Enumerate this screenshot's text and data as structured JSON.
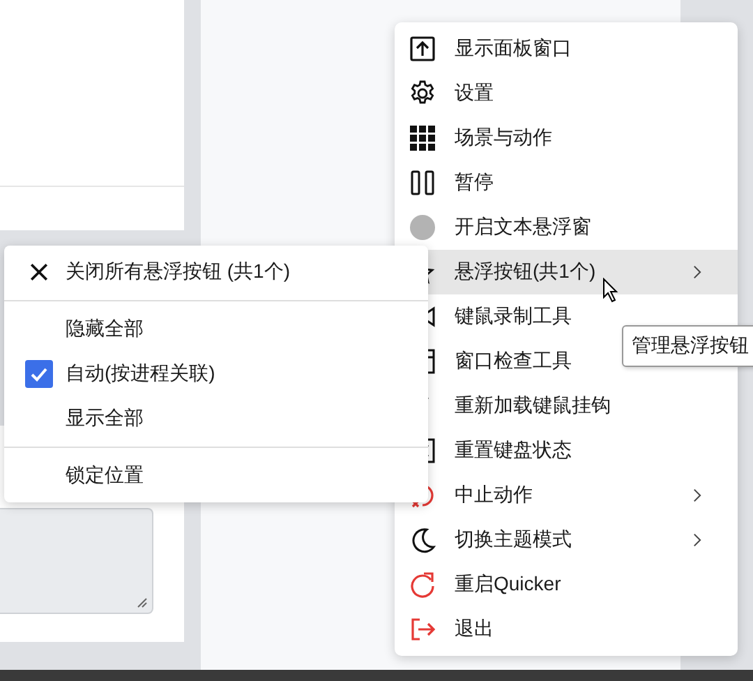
{
  "menu": {
    "items": [
      {
        "label": "显示面板窗口",
        "kind": "panel",
        "submenu": false,
        "highlighted": false
      },
      {
        "label": "设置",
        "kind": "gear",
        "submenu": false,
        "highlighted": false
      },
      {
        "label": "场景与动作",
        "kind": "grid",
        "submenu": false,
        "highlighted": false
      },
      {
        "label": "暂停",
        "kind": "pause",
        "submenu": false,
        "highlighted": false
      },
      {
        "label": "开启文本悬浮窗",
        "kind": "dot",
        "submenu": false,
        "highlighted": false
      },
      {
        "label": "悬浮按钮(共1个)",
        "kind": "float",
        "submenu": true,
        "highlighted": true
      },
      {
        "label": "键鼠录制工具",
        "kind": "record",
        "submenu": false,
        "highlighted": false
      },
      {
        "label": "窗口检查工具",
        "kind": "window",
        "submenu": false,
        "highlighted": false
      },
      {
        "label": "重新加载键鼠挂钩",
        "kind": "hook",
        "submenu": false,
        "highlighted": false
      },
      {
        "label": "重置键盘状态",
        "kind": "key",
        "submenu": false,
        "highlighted": false
      },
      {
        "label": "中止动作",
        "kind": "stop",
        "submenu": true,
        "highlighted": false
      },
      {
        "label": "切换主题模式",
        "kind": "moon",
        "submenu": true,
        "highlighted": false
      },
      {
        "label": "重启Quicker",
        "kind": "restart",
        "submenu": false,
        "highlighted": false
      },
      {
        "label": "退出",
        "kind": "exit",
        "submenu": false,
        "highlighted": false
      }
    ]
  },
  "submenu": {
    "items": [
      {
        "kind": "close",
        "label": "关闭所有悬浮按钮 (共1个)"
      },
      {
        "kind": "separator"
      },
      {
        "kind": "check",
        "label": "隐藏全部",
        "checked": false
      },
      {
        "kind": "check",
        "label": "自动(按进程关联)",
        "checked": true
      },
      {
        "kind": "check",
        "label": "显示全部",
        "checked": false
      },
      {
        "kind": "separator"
      },
      {
        "kind": "check",
        "label": "锁定位置",
        "checked": false
      }
    ]
  },
  "tooltip": {
    "text": "管理悬浮按钮"
  }
}
